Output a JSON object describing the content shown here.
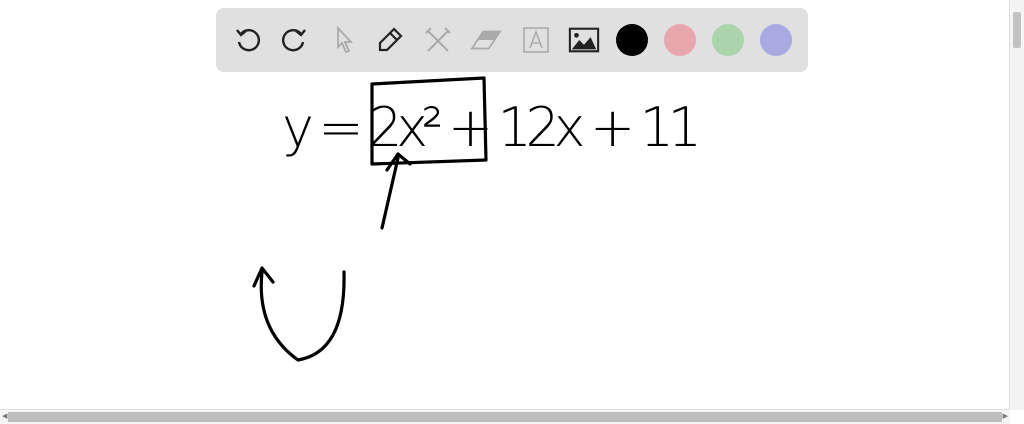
{
  "toolbar": {
    "tools": [
      "undo-icon",
      "redo-icon",
      "select-icon",
      "pen-icon",
      "tools-icon",
      "eraser-icon",
      "text-icon",
      "image-icon"
    ],
    "colors": [
      "#000000",
      "#e6a6ab",
      "#acd4ac",
      "#aaaae2"
    ],
    "selected_color": "#000000"
  },
  "canvas": {
    "handwriting": "y = 2x² + 12x + 11"
  }
}
